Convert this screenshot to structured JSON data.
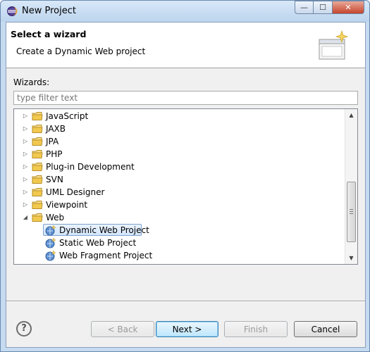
{
  "window": {
    "title": "New Project",
    "controls": {
      "minimize": "—",
      "maximize": "☐",
      "close": "✕"
    }
  },
  "banner": {
    "title": "Select a wizard",
    "subtitle": "Create a Dynamic Web project"
  },
  "wizards": {
    "label": "Wizards:",
    "filter_placeholder": "type filter text",
    "filter_value": ""
  },
  "tree": {
    "items": [
      {
        "label": "JavaScript",
        "type": "folder",
        "expanded": false
      },
      {
        "label": "JAXB",
        "type": "folder",
        "expanded": false
      },
      {
        "label": "JPA",
        "type": "folder",
        "expanded": false
      },
      {
        "label": "PHP",
        "type": "folder",
        "expanded": false
      },
      {
        "label": "Plug-in Development",
        "type": "folder",
        "expanded": false
      },
      {
        "label": "SVN",
        "type": "folder",
        "expanded": false
      },
      {
        "label": "UML Designer",
        "type": "folder",
        "expanded": false
      },
      {
        "label": "Viewpoint",
        "type": "folder",
        "expanded": false
      },
      {
        "label": "Web",
        "type": "folder",
        "expanded": true
      },
      {
        "label": "Dynamic Web Project",
        "type": "wizard",
        "selected": true
      },
      {
        "label": "Static Web Project",
        "type": "wizard",
        "selected": false
      },
      {
        "label": "Web Fragment Project",
        "type": "wizard",
        "selected": false
      }
    ]
  },
  "buttons": {
    "help": "?",
    "back": "< Back",
    "next": "Next >",
    "finish": "Finish",
    "cancel": "Cancel"
  },
  "colors": {
    "folder": "#e8c25a",
    "selection": "#d3e6fb",
    "frame": "#c6dbf0"
  }
}
